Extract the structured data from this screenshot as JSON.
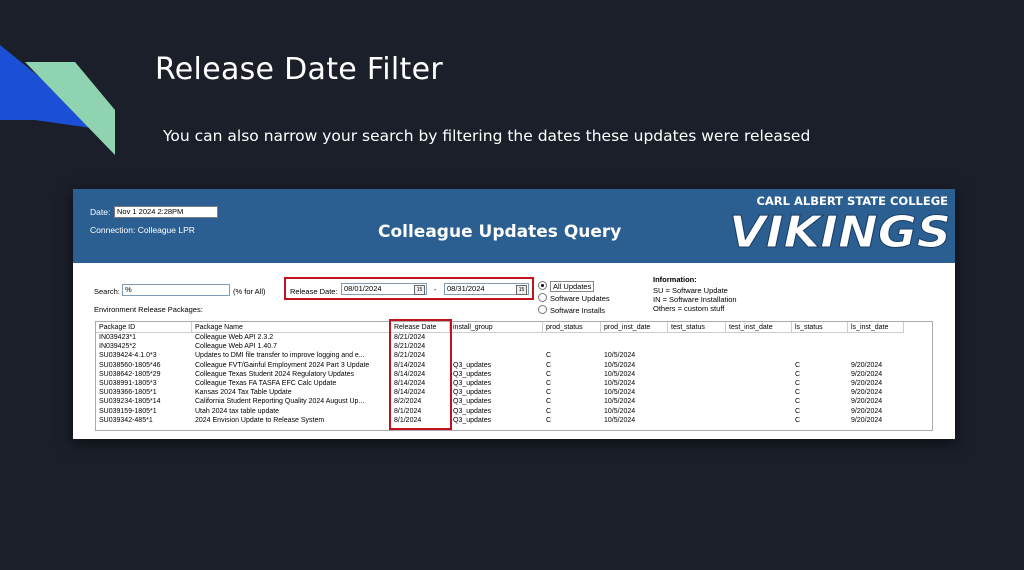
{
  "slide": {
    "title": "Release Date Filter",
    "subtitle": "You can also narrow your search by filtering the dates these updates were released"
  },
  "colors": {
    "background": "#1b1f2a",
    "header_blue": "#2b5f91",
    "accent_blue": "#1b4fd6",
    "accent_green": "#8fd3b0",
    "highlight_red": "#c1121f"
  },
  "header": {
    "date_label": "Date:",
    "date_value": "Nov  1 2024  2:28PM",
    "connection": "Connection: Colleague LPR",
    "title": "Colleague Updates Query",
    "logo_top": "CARL ALBERT STATE COLLEGE",
    "logo_main": "VIKINGS"
  },
  "filters": {
    "search_label": "Search:",
    "search_value": "%",
    "search_hint": "(% for All)",
    "env_label": "Environment Release Packages:",
    "release_date_label": "Release Date:",
    "date_from": "08/01/2024",
    "date_to": "08/31/2024",
    "date_sep": "-",
    "calendar_icon": "calendar-icon",
    "radio_options": [
      "All Updates",
      "Software Updates",
      "Software Installs"
    ],
    "radio_selected": "All Updates"
  },
  "information": {
    "title": "Information:",
    "lines": [
      "SU = Software Update",
      "IN = Software Installation",
      "Others = custom stuff"
    ]
  },
  "table": {
    "columns": [
      "Package ID",
      "Package Name",
      "Release Date",
      "install_group",
      "prod_status",
      "prod_inst_date",
      "test_status",
      "test_inst_date",
      "ls_status",
      "ls_inst_date"
    ],
    "rows": [
      [
        "IN039423*1",
        "Colleague Web API 2.3.2",
        "8/21/2024",
        "",
        "",
        "",
        "",
        "",
        "",
        ""
      ],
      [
        "IN039425*2",
        "Colleague Web API 1.40.7",
        "8/21/2024",
        "",
        "",
        "",
        "",
        "",
        "",
        ""
      ],
      [
        "SU039424-4.1.0*3",
        "Updates to DMI file transfer to improve logging and e...",
        "8/21/2024",
        "",
        "C",
        "10/5/2024",
        "",
        "",
        "",
        ""
      ],
      [
        "SU038560-1805*46",
        "Colleague FVT/Gainful Employment 2024 Part 3 Update",
        "8/14/2024",
        "Q3_updates",
        "C",
        "10/5/2024",
        "",
        "",
        "C",
        "9/20/2024"
      ],
      [
        "SU038642-1805*29",
        "Colleague Texas Student 2024 Regulatory Updates",
        "8/14/2024",
        "Q3_updates",
        "C",
        "10/5/2024",
        "",
        "",
        "C",
        "9/20/2024"
      ],
      [
        "SU038991-1805*3",
        "Colleague Texas FA TASFA EFC Calc Update",
        "8/14/2024",
        "Q3_updates",
        "C",
        "10/5/2024",
        "",
        "",
        "C",
        "9/20/2024"
      ],
      [
        "SU039366-1805*1",
        "Kansas 2024 Tax Table Update",
        "8/14/2024",
        "Q3_updates",
        "C",
        "10/5/2024",
        "",
        "",
        "C",
        "9/20/2024"
      ],
      [
        "SU039234-1805*14",
        "California Student Reporting Quality 2024 August Up...",
        "8/2/2024",
        "Q3_updates",
        "C",
        "10/5/2024",
        "",
        "",
        "C",
        "9/20/2024"
      ],
      [
        "SU039159-1805*1",
        "Utah 2024 tax table update",
        "8/1/2024",
        "Q3_updates",
        "C",
        "10/5/2024",
        "",
        "",
        "C",
        "9/20/2024"
      ],
      [
        "SU039342-485*1",
        "2024 Envision Update to Release System",
        "8/1/2024",
        "Q3_updates",
        "C",
        "10/5/2024",
        "",
        "",
        "C",
        "9/20/2024"
      ]
    ]
  }
}
